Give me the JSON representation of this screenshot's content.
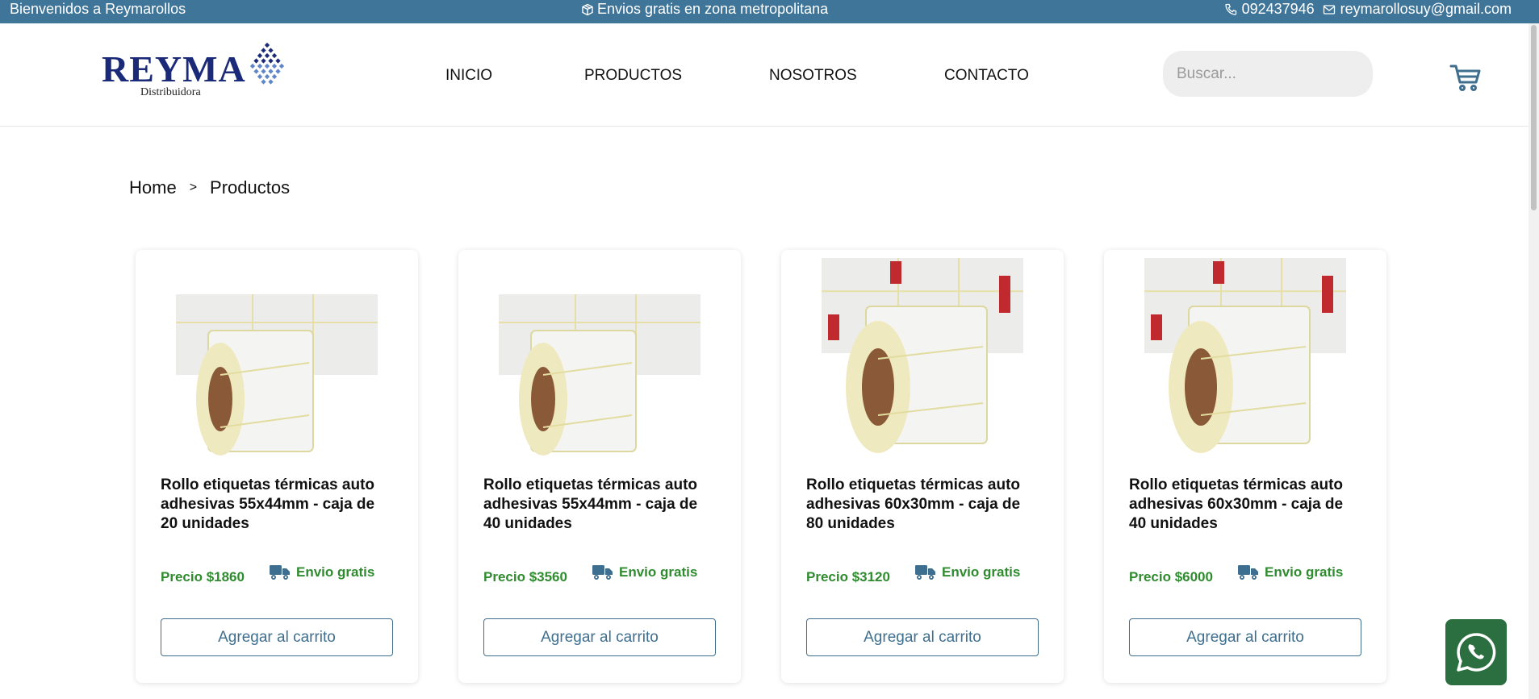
{
  "topbar": {
    "welcome": "Bienvenidos a Reymarollos",
    "shipping": "Envios gratis en zona metropolitana",
    "phone": "092437946",
    "email": "reymarollosuy@gmail.com"
  },
  "brand": {
    "name": "REYMA",
    "subtitle": "Distribuidora",
    "color": "#1b2a78"
  },
  "nav": [
    "INICIO",
    "PRODUCTOS",
    "NOSOTROS",
    "CONTACTO"
  ],
  "search": {
    "placeholder": "Buscar...",
    "value": ""
  },
  "breadcrumb": {
    "home": "Home",
    "separator": ">",
    "current": "Productos"
  },
  "products": [
    {
      "title": "Rollo etiquetas térmicas auto adhesivas 55x44mm - caja de 20 unidades",
      "price": "Precio $1860",
      "shipping": "Envio gratis",
      "button": "Agregar al carrito"
    },
    {
      "title": "Rollo etiquetas térmicas auto adhesivas 55x44mm - caja de 40 unidades",
      "price": "Precio $3560",
      "shipping": "Envio gratis",
      "button": "Agregar al carrito"
    },
    {
      "title": "Rollo etiquetas térmicas auto adhesivas 60x30mm - caja de 80 unidades",
      "price": "Precio $3120",
      "shipping": "Envio gratis",
      "button": "Agregar al carrito"
    },
    {
      "title": "Rollo etiquetas térmicas auto adhesivas 60x30mm - caja de 40 unidades",
      "price": "Precio $6000",
      "shipping": "Envio gratis",
      "button": "Agregar al carrito"
    }
  ],
  "colors": {
    "topbar": "#3f7599",
    "price": "#2e8b2e",
    "button": "#3f6f8f",
    "whatsapp": "#2b6e3f"
  },
  "icons": [
    "box-icon",
    "phone-icon",
    "mail-icon",
    "cart-icon",
    "truck-icon",
    "whatsapp-icon"
  ]
}
